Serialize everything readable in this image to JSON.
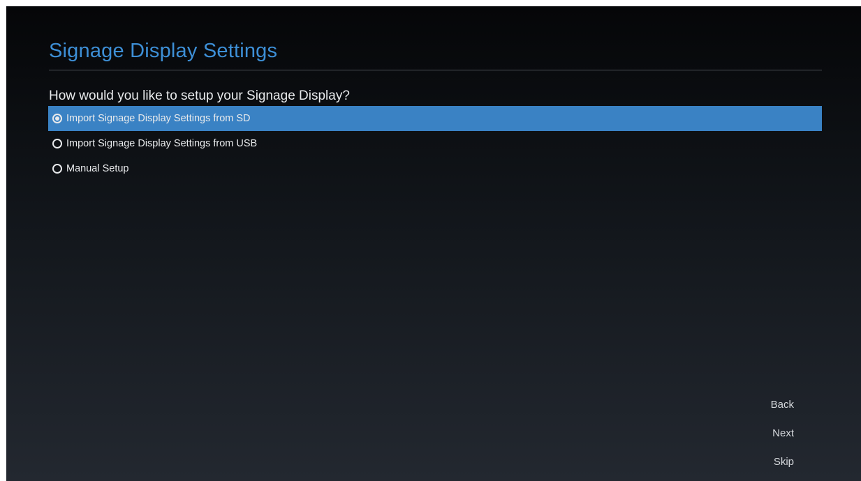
{
  "header": {
    "title": "Signage Display Settings"
  },
  "question": "How would you like to setup your Signage Display?",
  "options": [
    {
      "label": "Import Signage Display Settings from SD",
      "selected": true
    },
    {
      "label": "Import Signage Display Settings from USB",
      "selected": false
    },
    {
      "label": "Manual Setup",
      "selected": false
    }
  ],
  "nav": {
    "back_label": "Back",
    "next_label": "Next",
    "skip_label": "Skip"
  },
  "colors": {
    "title": "#3d8fd6",
    "selection": "#3a82c4",
    "text": "#e8eaec"
  }
}
